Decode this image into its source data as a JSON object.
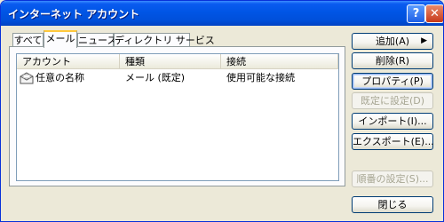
{
  "window": {
    "title": "インターネット アカウント",
    "help_label": "?",
    "close_label": "✕"
  },
  "tabs": [
    {
      "label": "すべて"
    },
    {
      "label": "メール"
    },
    {
      "label": "ニュース"
    },
    {
      "label": "ディレクトリ サービス"
    }
  ],
  "active_tab": "メール",
  "list": {
    "columns": [
      "アカウント",
      "種類",
      "接続"
    ],
    "rows": [
      {
        "account": "任意の名称",
        "type": "メール (既定)",
        "connection": "使用可能な接続",
        "icon": "mail-account-icon"
      }
    ]
  },
  "buttons": {
    "add": "追加(A)",
    "add_arrow": "▶",
    "delete": "削除(R)",
    "properties": "プロパティ(P)",
    "set_default": "既定に設定(D)",
    "import": "インポート(I)...",
    "export": "エクスポート(E)...",
    "order": "順番の設定(S)...",
    "close": "閉じる"
  },
  "colors": {
    "title_bar": "#0054e3",
    "tab_highlight": "#ffc83c",
    "disabled_text": "#a7a693"
  }
}
